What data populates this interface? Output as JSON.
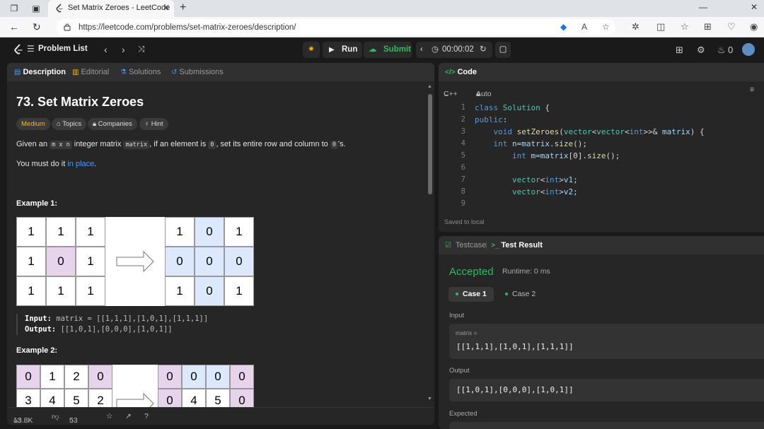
{
  "browser": {
    "tab_title": "Set Matrix Zeroes - LeetCode",
    "url": "https://leetcode.com/problems/set-matrix-zeroes/description/"
  },
  "topbar": {
    "problem_list": "Problem List",
    "run": "Run",
    "submit": "Submit",
    "timer": "00:00:02",
    "streak_count": "0"
  },
  "left_tabs": {
    "description": "Description",
    "editorial": "Editorial",
    "solutions": "Solutions",
    "submissions": "Submissions"
  },
  "problem": {
    "title": "73. Set Matrix Zeroes",
    "difficulty": "Medium",
    "chips": {
      "topics": "Topics",
      "companies": "Companies",
      "hint": "Hint"
    },
    "p1_a": "Given an ",
    "p1_code1": "m x n",
    "p1_b": " integer matrix ",
    "p1_code2": "matrix",
    "p1_c": ", if an element is ",
    "p1_code3": "0",
    "p1_d": ", set its entire row and column to ",
    "p1_code4": "0",
    "p1_e": "'s.",
    "p2_a": "You must do it ",
    "p2_link": "in place",
    "p2_b": ".",
    "example1": {
      "title": "Example 1:",
      "input_matrix": [
        [
          1,
          1,
          1
        ],
        [
          1,
          0,
          1
        ],
        [
          1,
          1,
          1
        ]
      ],
      "output_matrix": [
        [
          1,
          0,
          1
        ],
        [
          0,
          0,
          0
        ],
        [
          1,
          0,
          1
        ]
      ],
      "input_label": "Input:",
      "input_value": "matrix = [[1,1,1],[1,0,1],[1,1,1]]",
      "output_label": "Output:",
      "output_value": "[[1,0,1],[0,0,0],[1,0,1]]"
    },
    "example2": {
      "title": "Example 2:",
      "input_rows": [
        [
          0,
          1,
          2,
          0
        ],
        [
          3,
          4,
          5,
          2
        ]
      ],
      "output_rows": [
        [
          0,
          0,
          0,
          0
        ],
        [
          0,
          4,
          5,
          0
        ]
      ]
    }
  },
  "footer": {
    "likes": "13.8K",
    "comments": "53"
  },
  "code_panel": {
    "title": "Code",
    "language": "C++",
    "mode": "Auto",
    "saved": "Saved to local",
    "lines": [
      "1",
      "2",
      "3",
      "4",
      "5",
      "6",
      "7",
      "8",
      "9"
    ]
  },
  "result_panel": {
    "testcase_tab": "Testcase",
    "result_tab": "Test Result",
    "status": "Accepted",
    "runtime": "Runtime: 0 ms",
    "case1": "Case 1",
    "case2": "Case 2",
    "input_label": "Input",
    "input_sub": "matrix =",
    "input_value": "[[1,1,1],[1,0,1],[1,1,1]]",
    "output_label": "Output",
    "output_value": "[[1,0,1],[0,0,0],[1,0,1]]",
    "expected_label": "Expected"
  },
  "colors": {
    "accent_green": "#2cbb5d",
    "medium": "#ffb800",
    "link": "#3e9bff"
  }
}
